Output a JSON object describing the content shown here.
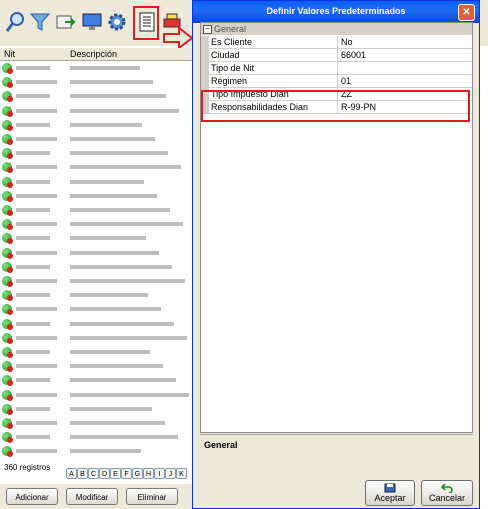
{
  "dialog": {
    "title": "Definir Valores Predeterminados",
    "category": "General",
    "properties": [
      {
        "key": "Es Cliente",
        "value": "No"
      },
      {
        "key": "Ciudad",
        "value": "66001"
      },
      {
        "key": "Tipo de Nit",
        "value": ""
      },
      {
        "key": "Régimen",
        "value": "01"
      },
      {
        "key": "Tipo Impuesto Dian",
        "value": "ZZ"
      },
      {
        "key": "Responsabilidades Dian",
        "value": "R-99-PN"
      }
    ],
    "description_title": "General",
    "accept_label": "Aceptar",
    "cancel_label": "Cancelar"
  },
  "grid": {
    "col_nit": "Nit",
    "col_desc": "Descripción"
  },
  "footer": {
    "count": "360 registros",
    "letters": [
      "A",
      "B",
      "C",
      "D",
      "E",
      "F",
      "G",
      "H",
      "I",
      "J",
      "K"
    ],
    "add_label": "Adicionar",
    "modify_label": "Modificar",
    "delete_label": "Eliminar"
  },
  "colors": {
    "highlight": "#e01b24",
    "titlebar": "#0a5ff0"
  }
}
